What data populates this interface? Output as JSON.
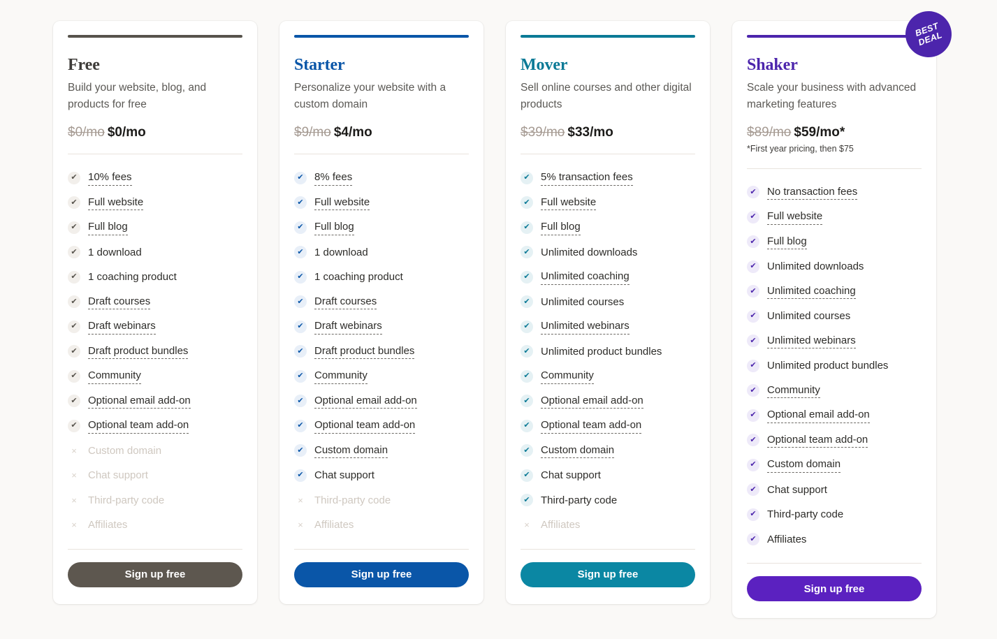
{
  "page": {
    "background": "#faf9f7",
    "signup_label": "Sign up free",
    "badge": {
      "line1": "BEST",
      "line2": "DEAL",
      "color": "#4c25ac"
    }
  },
  "plans": [
    {
      "name": "Free",
      "accent": "#57534c",
      "name_color": "#3d3b38",
      "check_bg": "#f2efeb",
      "check_color": "#57534c",
      "button_bg": "#5d574f",
      "description": "Build your website, blog, and products for free",
      "price_old": "$0/mo",
      "price_new": "$0/mo",
      "price_note": "",
      "features": [
        {
          "label": "10% fees",
          "included": true,
          "tooltip": true
        },
        {
          "label": "Full website",
          "included": true,
          "tooltip": true
        },
        {
          "label": "Full blog",
          "included": true,
          "tooltip": true
        },
        {
          "label": "1 download",
          "included": true,
          "tooltip": false
        },
        {
          "label": "1 coaching product",
          "included": true,
          "tooltip": false
        },
        {
          "label": "Draft courses",
          "included": true,
          "tooltip": true
        },
        {
          "label": "Draft webinars",
          "included": true,
          "tooltip": true
        },
        {
          "label": "Draft product bundles",
          "included": true,
          "tooltip": true
        },
        {
          "label": "Community",
          "included": true,
          "tooltip": true
        },
        {
          "label": "Optional email add-on",
          "included": true,
          "tooltip": true
        },
        {
          "label": "Optional team add-on",
          "included": true,
          "tooltip": true
        },
        {
          "label": "Custom domain",
          "included": false,
          "tooltip": false
        },
        {
          "label": "Chat support",
          "included": false,
          "tooltip": false
        },
        {
          "label": "Third-party code",
          "included": false,
          "tooltip": false
        },
        {
          "label": "Affiliates",
          "included": false,
          "tooltip": false
        }
      ]
    },
    {
      "name": "Starter",
      "accent": "#0a56a8",
      "name_color": "#0a56a8",
      "check_bg": "#e8eff8",
      "check_color": "#0a56a8",
      "button_bg": "#0a56a8",
      "description": "Personalize your website with a custom domain",
      "price_old": "$9/mo",
      "price_new": "$4/mo",
      "price_note": "",
      "features": [
        {
          "label": "8% fees",
          "included": true,
          "tooltip": true
        },
        {
          "label": "Full website",
          "included": true,
          "tooltip": true
        },
        {
          "label": "Full blog",
          "included": true,
          "tooltip": true
        },
        {
          "label": "1 download",
          "included": true,
          "tooltip": false
        },
        {
          "label": "1 coaching product",
          "included": true,
          "tooltip": false
        },
        {
          "label": "Draft courses",
          "included": true,
          "tooltip": true
        },
        {
          "label": "Draft webinars",
          "included": true,
          "tooltip": true
        },
        {
          "label": "Draft product bundles",
          "included": true,
          "tooltip": true
        },
        {
          "label": "Community",
          "included": true,
          "tooltip": true
        },
        {
          "label": "Optional email add-on",
          "included": true,
          "tooltip": true
        },
        {
          "label": "Optional team add-on",
          "included": true,
          "tooltip": true
        },
        {
          "label": "Custom domain",
          "included": true,
          "tooltip": true
        },
        {
          "label": "Chat support",
          "included": true,
          "tooltip": false
        },
        {
          "label": "Third-party code",
          "included": false,
          "tooltip": false
        },
        {
          "label": "Affiliates",
          "included": false,
          "tooltip": false
        }
      ]
    },
    {
      "name": "Mover",
      "accent": "#0b7a96",
      "name_color": "#0b7a96",
      "check_bg": "#e5f1f4",
      "check_color": "#0b7a96",
      "button_bg": "#0b87a3",
      "description": "Sell online courses and other digital products",
      "price_old": "$39/mo",
      "price_new": "$33/mo",
      "price_note": "",
      "features": [
        {
          "label": "5% transaction fees",
          "included": true,
          "tooltip": true
        },
        {
          "label": "Full website",
          "included": true,
          "tooltip": true
        },
        {
          "label": "Full blog",
          "included": true,
          "tooltip": true
        },
        {
          "label": "Unlimited downloads",
          "included": true,
          "tooltip": false
        },
        {
          "label": "Unlimited coaching",
          "included": true,
          "tooltip": true
        },
        {
          "label": "Unlimited courses",
          "included": true,
          "tooltip": false
        },
        {
          "label": "Unlimited webinars",
          "included": true,
          "tooltip": true
        },
        {
          "label": "Unlimited product bundles",
          "included": true,
          "tooltip": false
        },
        {
          "label": "Community",
          "included": true,
          "tooltip": true
        },
        {
          "label": "Optional email add-on",
          "included": true,
          "tooltip": true
        },
        {
          "label": "Optional team add-on",
          "included": true,
          "tooltip": true
        },
        {
          "label": "Custom domain",
          "included": true,
          "tooltip": true
        },
        {
          "label": "Chat support",
          "included": true,
          "tooltip": false
        },
        {
          "label": "Third-party code",
          "included": true,
          "tooltip": false
        },
        {
          "label": "Affiliates",
          "included": false,
          "tooltip": false
        }
      ]
    },
    {
      "name": "Shaker",
      "accent": "#4c25ac",
      "name_color": "#4c25ac",
      "check_bg": "#eeeaf9",
      "check_color": "#4c25ac",
      "button_bg": "#5b21c0",
      "description": "Scale your business with advanced marketing features",
      "price_old": "$89/mo",
      "price_new": "$59/mo*",
      "price_note": "*First year pricing, then $75",
      "badge": true,
      "features": [
        {
          "label": "No transaction fees",
          "included": true,
          "tooltip": true
        },
        {
          "label": "Full website",
          "included": true,
          "tooltip": true
        },
        {
          "label": "Full blog",
          "included": true,
          "tooltip": true
        },
        {
          "label": "Unlimited downloads",
          "included": true,
          "tooltip": false
        },
        {
          "label": "Unlimited coaching",
          "included": true,
          "tooltip": true
        },
        {
          "label": "Unlimited courses",
          "included": true,
          "tooltip": false
        },
        {
          "label": "Unlimited webinars",
          "included": true,
          "tooltip": true
        },
        {
          "label": "Unlimited product bundles",
          "included": true,
          "tooltip": false
        },
        {
          "label": "Community",
          "included": true,
          "tooltip": true
        },
        {
          "label": "Optional email add-on",
          "included": true,
          "tooltip": true
        },
        {
          "label": "Optional team add-on",
          "included": true,
          "tooltip": true
        },
        {
          "label": "Custom domain",
          "included": true,
          "tooltip": true
        },
        {
          "label": "Chat support",
          "included": true,
          "tooltip": false
        },
        {
          "label": "Third-party code",
          "included": true,
          "tooltip": false
        },
        {
          "label": "Affiliates",
          "included": true,
          "tooltip": false
        }
      ]
    }
  ]
}
